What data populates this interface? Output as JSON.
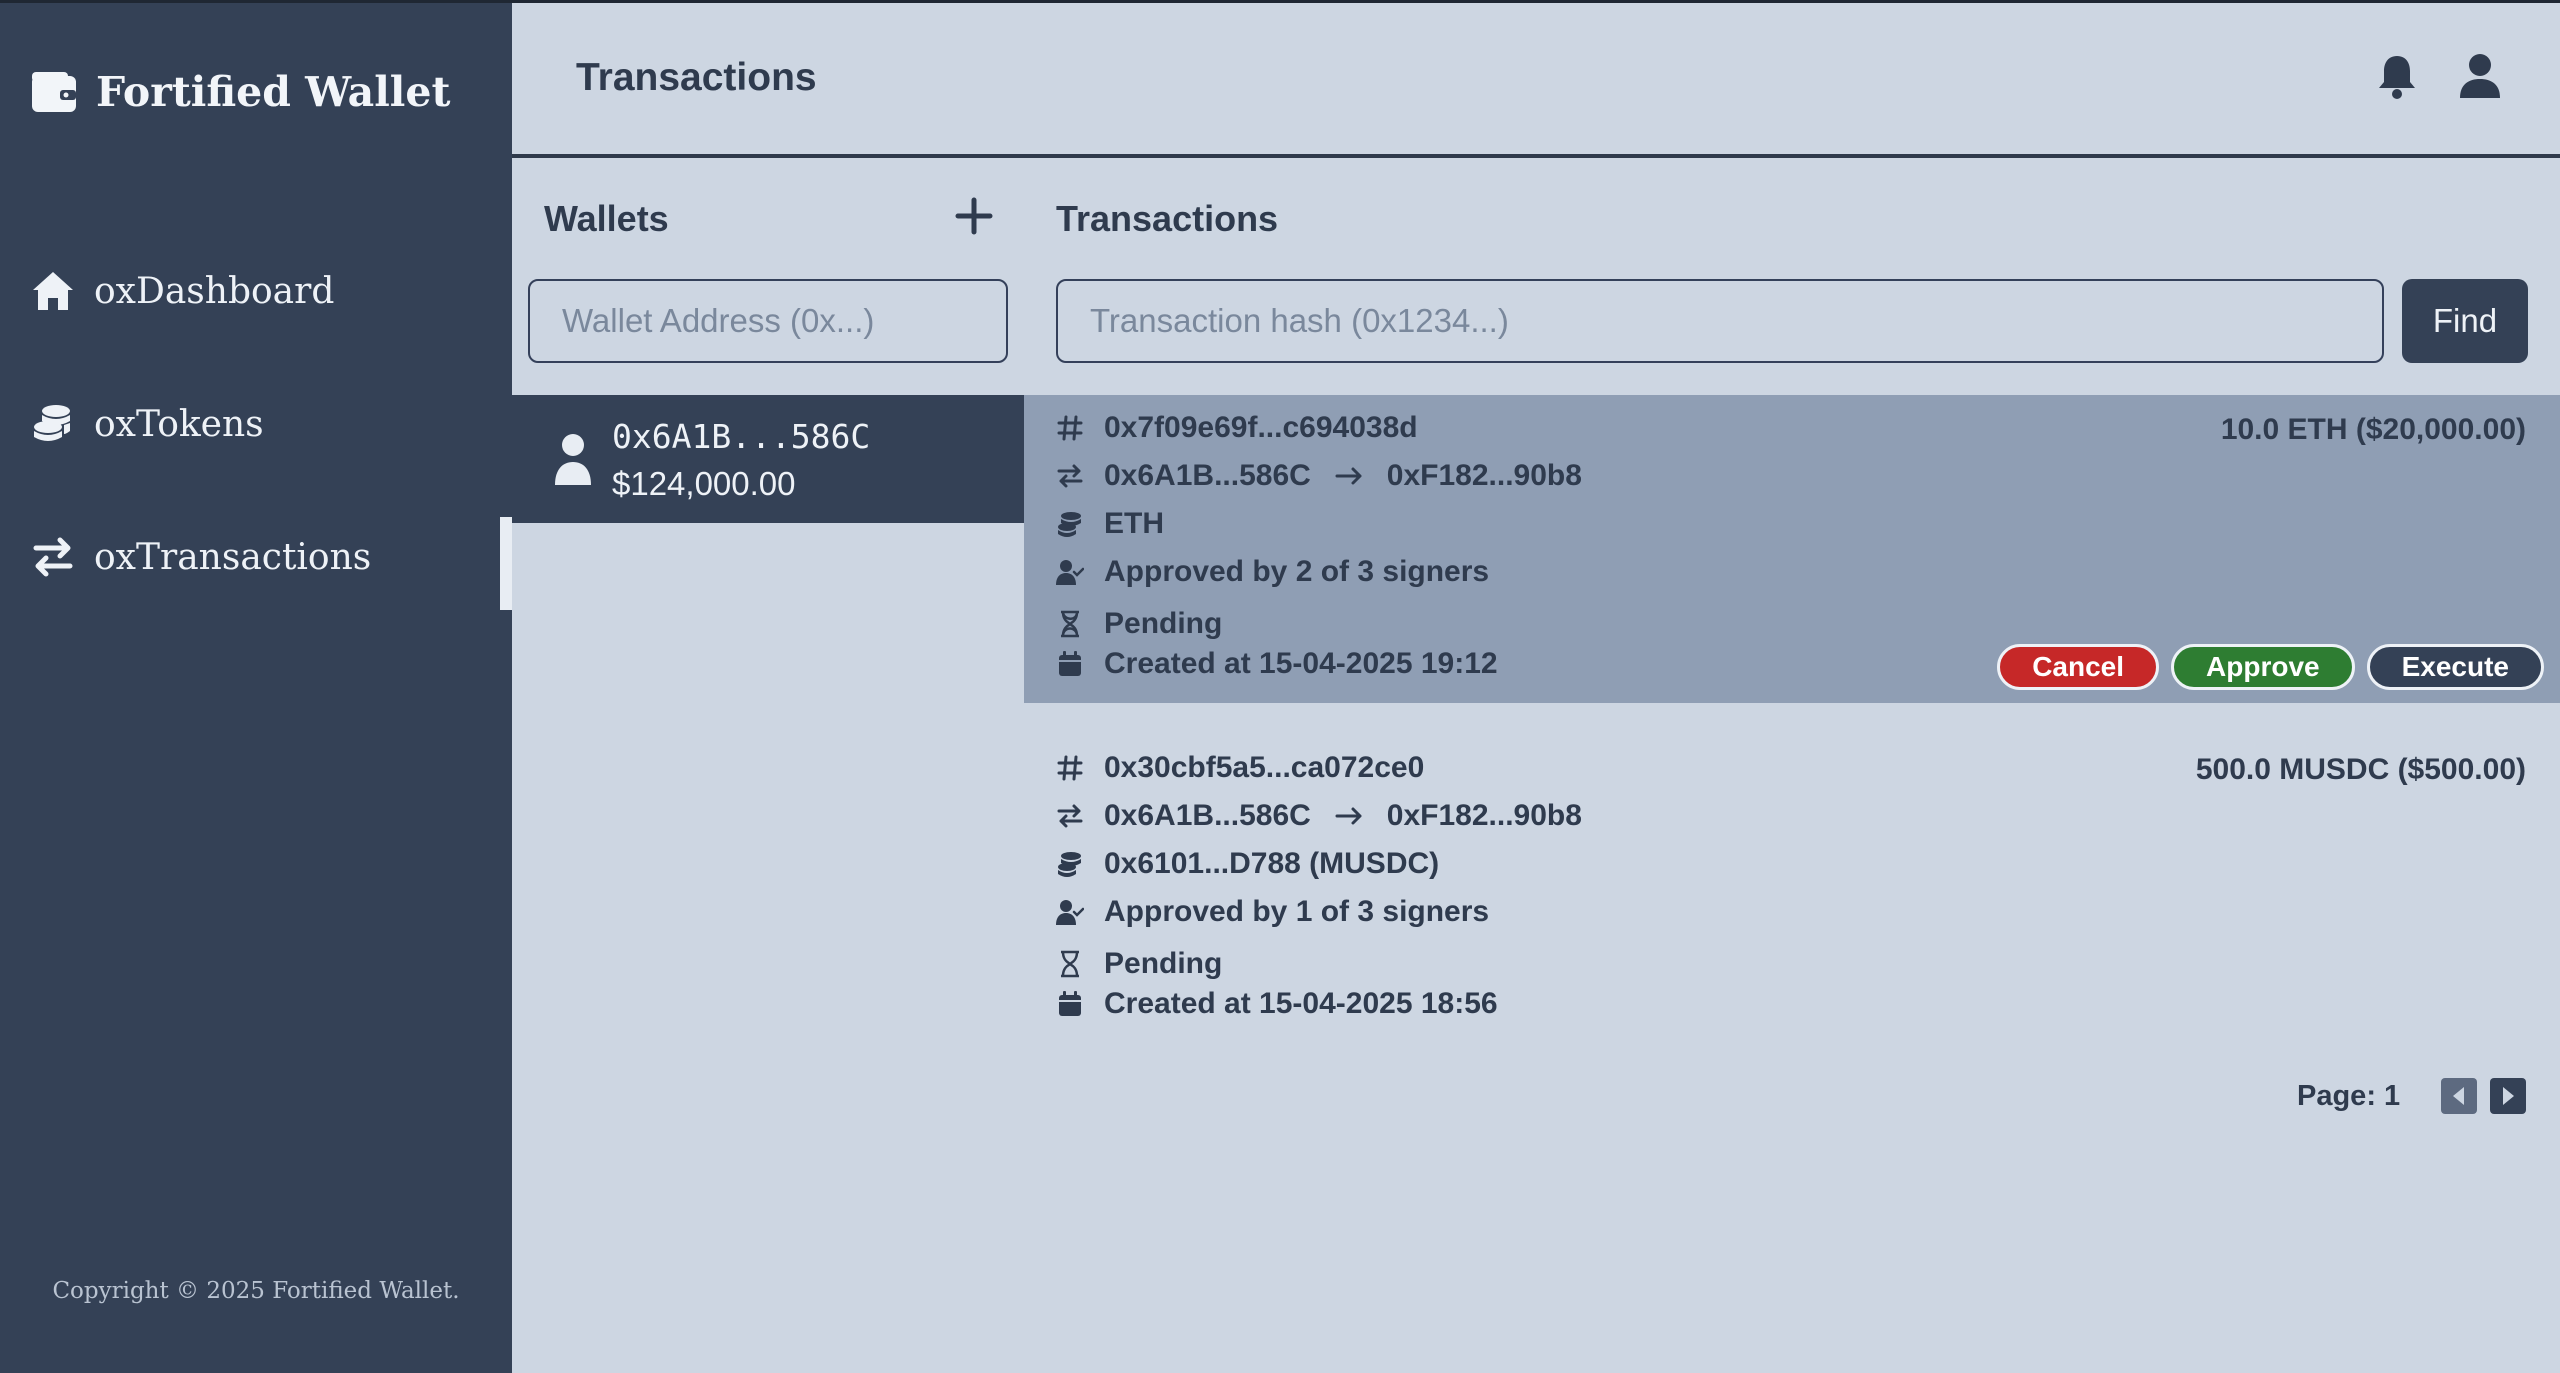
{
  "app": {
    "brand": "Fortified Wallet",
    "copyright": "Copyright © 2025 Fortified Wallet."
  },
  "sidebar": {
    "items": [
      {
        "label": "oxDashboard",
        "icon": "home-icon"
      },
      {
        "label": "oxTokens",
        "icon": "coins-icon"
      },
      {
        "label": "oxTransactions",
        "icon": "exchange-icon",
        "active": true
      }
    ]
  },
  "header": {
    "title": "Transactions",
    "icons": [
      "bell-icon",
      "user-icon"
    ]
  },
  "wallets": {
    "heading": "Wallets",
    "search_placeholder": "Wallet Address (0x...)",
    "items": [
      {
        "address": "0x6A1B...586C",
        "balance": "$124,000.00",
        "selected": true
      }
    ]
  },
  "transactions": {
    "heading": "Transactions",
    "search_placeholder": "Transaction hash (0x1234...)",
    "find_label": "Find",
    "items": [
      {
        "hash": "0x7f09e69f...c694038d",
        "amount": "10.0 ETH ($20,000.00)",
        "from": "0x6A1B...586C",
        "to": "0xF182...90b8",
        "token": "ETH",
        "approvals": "Approved by 2 of 3 signers",
        "status": "Pending",
        "created": "Created at 15-04-2025 19:12",
        "selected": true,
        "actions": {
          "cancel": "Cancel",
          "approve": "Approve",
          "execute": "Execute"
        }
      },
      {
        "hash": "0x30cbf5a5...ca072ce0",
        "amount": "500.0 MUSDC ($500.00)",
        "from": "0x6A1B...586C",
        "to": "0xF182...90b8",
        "token": "0x6101...D788 (MUSDC)",
        "approvals": "Approved by 1 of 3 signers",
        "status": "Pending",
        "created": "Created at 15-04-2025 18:56",
        "selected": false
      }
    ],
    "pagination": {
      "label": "Page: 1"
    }
  },
  "colors": {
    "sidebar": "#344156",
    "background": "#cdd6e2",
    "selected_row": "#8f9eb4",
    "cancel": "#c62828",
    "approve": "#2e7d32",
    "execute": "#344156"
  }
}
